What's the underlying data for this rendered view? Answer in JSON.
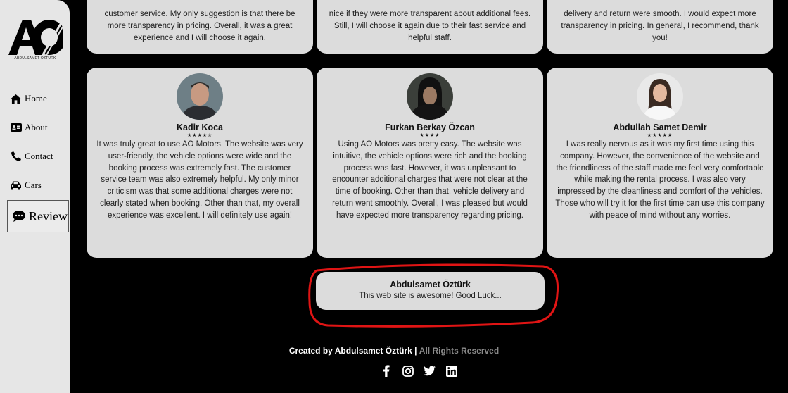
{
  "logo": {
    "caption": "ABDULSAMET ÖZTÜRK"
  },
  "nav": {
    "home": "Home",
    "about": "About",
    "contact": "Contact",
    "cars": "Cars",
    "review": "Review"
  },
  "top_cards": [
    {
      "text": "customer service. My only suggestion is that there be more transparency in pricing. Overall, it was a great experience and I will choose it again."
    },
    {
      "text": "nice if they were more transparent about additional fees. Still, I will choose it again due to their fast service and helpful staff."
    },
    {
      "text": "delivery and return were smooth. I would expect more transparency in pricing. In general, I recommend, thank you!"
    }
  ],
  "reviews": [
    {
      "name": "Kadir Koca",
      "stars": "★★★★✭",
      "text": "It was truly great to use AO Motors. The website was very user-friendly, the vehicle options were wide and the booking process was extremely fast. The customer service team was also extremely helpful. My only minor criticism was that some additional charges were not clearly stated when booking. Other than that, my overall experience was excellent. I will definitely use again!"
    },
    {
      "name": "Furkan Berkay Özcan",
      "stars": "★★★★",
      "text": "Using AO Motors was pretty easy. The website was intuitive, the vehicle options were rich and the booking process was fast. However, it was unpleasant to encounter additional charges that were not clear at the time of booking. Other than that, vehicle delivery and return went smoothly. Overall, I was pleased but would have expected more transparency regarding pricing."
    },
    {
      "name": "Abdullah Samet Demir",
      "stars": "★★★★★",
      "text": "I was really nervous as it was my first time using this company. However, the convenience of the website and the friendliness of the staff made me feel very comfortable while making the rental process. I was also very impressed by the cleanliness and comfort of the vehicles. Those who will try it for the first time can use this company with peace of mind without any worries."
    }
  ],
  "new_review": {
    "name": "Abdulsamet Öztürk",
    "text": "This web site is awesome! Good Luck..."
  },
  "footer": {
    "created_by": "Created by Abdulsamet Öztürk |",
    "rights": "All Rights Reserved",
    "socials": [
      "facebook-icon",
      "instagram-icon",
      "twitter-icon",
      "linkedin-icon"
    ]
  },
  "colors": {
    "background": "#000000",
    "card": "#dcdcdc",
    "sidebar": "#e6e6e6",
    "highlight": "#e01414"
  }
}
